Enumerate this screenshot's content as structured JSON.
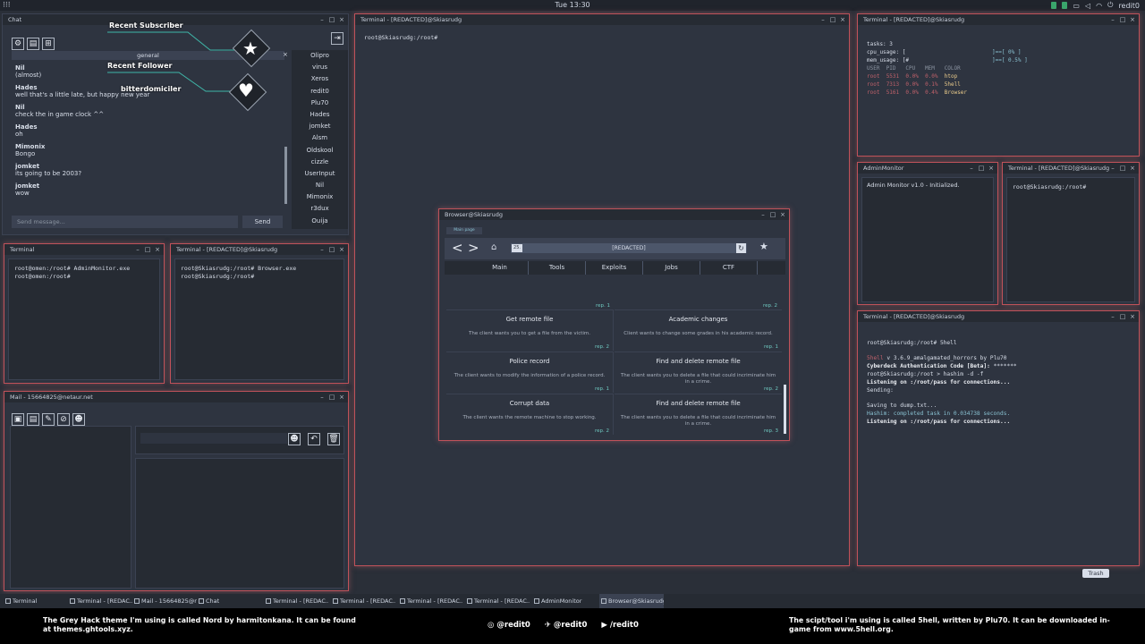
{
  "topbar": {
    "clock": "Tue 13:30",
    "apps_icon": "grid-icon",
    "user": "redit0"
  },
  "chat": {
    "title": "Chat",
    "channel": "general",
    "messages": [
      {
        "user": "Nil",
        "text": "(almost)"
      },
      {
        "user": "Hades",
        "text": "well that's a little late, but happy new year"
      },
      {
        "user": "Nil",
        "text": "check the in game clock ^^"
      },
      {
        "user": "Hades",
        "text": "oh"
      },
      {
        "user": "Mimonix",
        "text": "Bongo"
      },
      {
        "user": "jomket",
        "text": "its going to be 2003?"
      },
      {
        "user": "jomket",
        "text": "wow"
      }
    ],
    "users": [
      "Olipro",
      "virus",
      "Xeros",
      "redit0",
      "Plu70",
      "Hades",
      "jomket",
      "Alsm",
      "Oldskool",
      "cizzle",
      "UserInput",
      "Nil",
      "Mimonix",
      "r3dux",
      "Ouija"
    ],
    "input_placeholder": "Send message...",
    "send_label": "Send"
  },
  "overlay": {
    "subscriber_label": "Recent Subscriber",
    "follower_label": "Recent Follower",
    "follower_name": "bitterdomiciler"
  },
  "term_local": {
    "title": "Terminal",
    "lines": [
      "root@omen:/root# AdminMonitor.exe",
      "root@omen:/root#"
    ]
  },
  "term_browser": {
    "title": "Terminal - [REDACTED]@Skiasrudg",
    "lines": [
      "root@Skiasrudg:/root# Browser.exe",
      "root@Skiasrudg:/root#"
    ]
  },
  "term_main": {
    "title": "Terminal - [REDACTED]@Skiasrudg",
    "lines": [
      "root@Skiasrudg:/root#"
    ]
  },
  "htop": {
    "title": "Terminal - [REDACTED]@Skiasrudg",
    "tasks": "tasks: 3",
    "cpu_label": "cpu_usage: [",
    "cpu_val": "]==[ 0% ]",
    "mem_label": "mem_usage: [#",
    "mem_val": "]==[ 0.5% ]",
    "header": "USER  PID   CPU   MEM   COLOR",
    "rows": [
      {
        "user": "root",
        "pid": "5531",
        "cpu": "0.0%",
        "mem": "0.0%",
        "name": "htop"
      },
      {
        "user": "root",
        "pid": "7313",
        "cpu": "0.0%",
        "mem": "0.1%",
        "name": "5hell"
      },
      {
        "user": "root",
        "pid": "5161",
        "cpu": "0.0%",
        "mem": "0.4%",
        "name": "Browser"
      }
    ]
  },
  "admin": {
    "title": "AdminMonitor",
    "text": "Admin Monitor v1.0 - Initialized."
  },
  "term_small": {
    "title": "Terminal - [REDACTED]@Skiasrudg",
    "lines": [
      "root@Skiasrudg:/root#"
    ]
  },
  "shell": {
    "title": "Terminal - [REDACTED]@Skiasrudg",
    "l1": "root@Skiasrudg:/root# 5hell",
    "l2_red": "5hell",
    "l2": " v 3.6.9_amalgamated_horrors by Plu70",
    "l3a": "Cyberdeck Authentication Code [Beta]:",
    "l3b": " *******",
    "l4": "root@Skiasrudg:/root ",
    "l4b": "> hashim -d -f",
    "l5": "Listening on :/root/pass for connections...",
    "l6": "Sending:",
    "l7": "Saving to dump.txt...",
    "l8a": "Hashim: completed task in 0.034738 seconds.",
    "l9": "Listening on :/root/pass for connections..."
  },
  "mail": {
    "title": "Mail - 15664825@netaur.net"
  },
  "browser": {
    "title": "Browser@Skiasrudg",
    "tab": "Main page",
    "url": "[REDACTED]",
    "url_prefix": "25.",
    "nav": [
      "Main",
      "Tools",
      "Exploits",
      "Jobs",
      "CTF"
    ],
    "top_reps": [
      "rep. 1",
      "rep. 2"
    ],
    "jobs": [
      {
        "title": "Get remote file",
        "desc": "The client wants you to get a file from the victim.",
        "rep": "rep. 2"
      },
      {
        "title": "Academic changes",
        "desc": "Client wants to change some grades in his academic record.",
        "rep": "rep. 1"
      },
      {
        "title": "Police record",
        "desc": "The client wants to modify the information of a police record.",
        "rep": "rep. 1"
      },
      {
        "title": "Find and delete remote file",
        "desc": "The client wants you to delete a file that could incriminate him in a crime.",
        "rep": "rep. 2"
      },
      {
        "title": "Corrupt data",
        "desc": "The client wants the remote machine to stop working.",
        "rep": "rep. 2"
      },
      {
        "title": "Find and delete remote file",
        "desc": "The client wants you to delete a file that could incriminate him in a crime.",
        "rep": "rep. 3"
      }
    ]
  },
  "trash": "Trash",
  "taskbar": [
    "Terminal",
    "Terminal - [REDAC...",
    "Mail - 15664825@n...",
    "Chat",
    "Terminal - [REDAC...",
    "Terminal - [REDAC...",
    "Terminal - [REDAC...",
    "Terminal - [REDAC...",
    "AdminMonitor",
    "Browser@Skiasrudg"
  ],
  "footer": {
    "left": "The Grey Hack theme I'm using is called Nord by harmitonkana. It can be found at themes.ghtools.xyz.",
    "handles": [
      "@redit0",
      "@redit0",
      "/redit0"
    ],
    "right": "The scipt/tool i'm using is called 5hell, written by Plu70.  It can be downloaded in-game from www.5hell.org."
  }
}
